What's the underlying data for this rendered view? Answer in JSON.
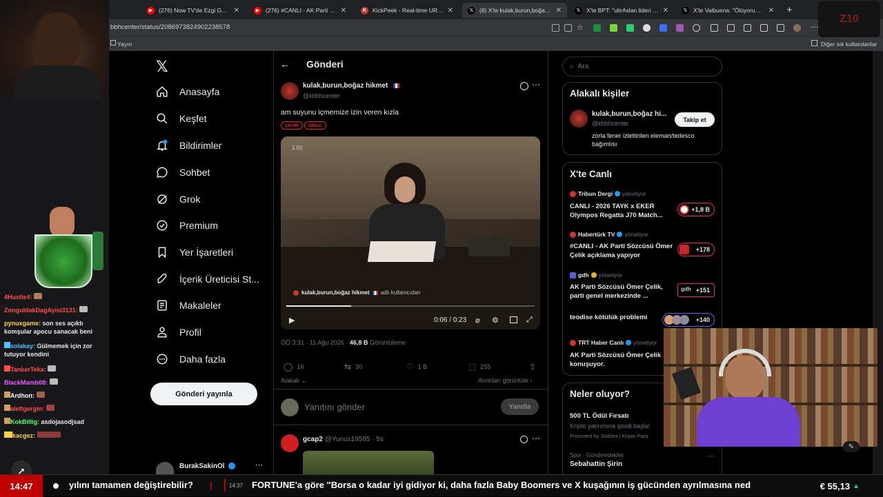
{
  "browser": {
    "tabs": [
      {
        "title": "(276) Now TV'de Ezgi Gözeger ile",
        "icon": "youtube-icon"
      },
      {
        "title": "(276) #CANLI - AK Parti Sözc",
        "icon": "youtube-icon"
      },
      {
        "title": "KickPeek - Real-time URL Crawle",
        "icon": "kickpeek-icon"
      },
      {
        "title": "(6) X'te kulak,burun,boğaz hikme",
        "icon": "x-icon"
      },
      {
        "title": "X'te BPT: \"ultrAslan lideri Sebaha",
        "icon": "x-icon"
      },
      {
        "title": "X'te Valbuena: \"Ölüyorum amk P",
        "icon": "x-icon"
      }
    ],
    "url": "bbhcenter/status/2086973824902238578",
    "bookmarks": {
      "left": "Yayın",
      "right": "Diğer sık kullanılanlar"
    }
  },
  "nav": {
    "items": [
      "Anasayfa",
      "Keşfet",
      "Bildirimler",
      "Sohbet",
      "Grok",
      "Premium",
      "Yer İşaretleri",
      "İçerik Üreticisi St...",
      "Makaleler",
      "Profil",
      "Daha fazla"
    ],
    "post_button": "Gönderi yayınla",
    "account_name": "BurakSakinOl"
  },
  "header": {
    "title": "Gönderi"
  },
  "post": {
    "author_name": "kulak,burun,boğaz hikmet",
    "handle": "@kbbhcenter",
    "text": "am suyunu içmemize izin veren kızla",
    "tags": [
      "ÇEVİR",
      "DİNLE"
    ],
    "video": {
      "speed": "1.00",
      "overlay_author": "kulak,burun,boğaz hikmet",
      "overlay_suffix": "adlı kullanıcıdan",
      "time": "0:06 / 0:23",
      "progress": 0.26
    },
    "meta": {
      "time": "ÖÖ 3:31 · 11 Ağu 2026 ·",
      "views": "46,8 B",
      "views_label": "Görüntüleme"
    },
    "stats": {
      "replies": "16",
      "reposts": "30",
      "likes": "1 B",
      "bookmarks": "255"
    },
    "related_label": "Alakalı",
    "quotes_label": "Alıntıları görüntüle",
    "reply_placeholder": "Yanıtını gönder",
    "reply_button": "Yanıtla"
  },
  "next_post": {
    "name": "gcap2",
    "handle": "@Yunus19595",
    "age": "5s"
  },
  "sidebar": {
    "search_placeholder": "Ara",
    "related_people": {
      "title": "Alakalı kişiler",
      "name": "kulak,burun,boğaz hi...",
      "handle": "@kbbhcenter",
      "bio": "zorla fener izlettirilen eleman/tedesco bağımlısı",
      "follow": "Takip et"
    },
    "live": {
      "title": "X'te Canlı",
      "items": [
        {
          "source": "Tribun Dergi",
          "role": "yönetiyor",
          "text": "CANLI - 2026 TAYK x EKER Olympos Regatta J70 Match...",
          "count": "+1,8 B"
        },
        {
          "source": "Habertürk TV",
          "role": "yönetiyor",
          "text": "#CANLI - AK Parti Sözcüsü Ömer Çelik açıklama yapıyor",
          "count": "+178"
        },
        {
          "source": "gdh",
          "role": "yönetiyor",
          "text": "AK Parti Sözcüsü Ömer Çelik, parti genel merkezinde ...",
          "count": "+151"
        },
        {
          "source": "",
          "role": "",
          "text": "teodise kötülük problemi",
          "count": "+140"
        },
        {
          "source": "TRT Haber Canlı",
          "role": "yönetiyor",
          "text": "AK Parti Sözcüsü Ömer Çelik konuşuyor.",
          "count": ""
        }
      ]
    },
    "trending": {
      "title": "Neler oluyor?",
      "promo_title": "500 TL Ödül Fırsatı",
      "promo_text": "Kripto yatırımına şimdi başla!",
      "promo_by": "Promoted by Stablex | Kripto Para",
      "trend_context": "Spor · Gündemdekiler",
      "trend_name": "Sebahattin Şirin"
    }
  },
  "stream_chat": [
    {
      "user": "4Hustle4:",
      "msg": "",
      "color": "#ff4d4d"
    },
    {
      "user": "ZonguldakDagAyisi3131:",
      "msg": "",
      "color": "#ff4d4d"
    },
    {
      "user": "pynuxgame:",
      "msg": "son ses açıktı komşular apocu sanacak beni",
      "color": "#ffd24d"
    },
    {
      "user": "solakay:",
      "msg": "Gülmemek için zor tutuyor kendini",
      "color": "#4dc3ff"
    },
    {
      "user": "TankerTeka:",
      "msg": "",
      "color": "#ff4d4d"
    },
    {
      "user": "BlackMamb08:",
      "msg": "",
      "color": "#e85dff"
    },
    {
      "user": "Ardhon:",
      "msg": "",
      "color": "#ffffff"
    },
    {
      "user": "alettgergin:",
      "msg": "",
      "color": "#ff4d4d"
    },
    {
      "user": "KokBillig:",
      "msg": "asdojasodjsad",
      "color": "#5cff6b"
    },
    {
      "user": "kacgez:",
      "msg": "",
      "color": "#ffd24d"
    }
  ],
  "ticker": {
    "clock": "14:47",
    "text1": "yılını tamamen değiştirebilir?",
    "time2": "14:37",
    "text2": "FORTUNE'a göre \"Borsa o kadar iyi gidiyor ki, daha fazla Baby Boomers ve X kuşağının iş gücünden ayrılmasına ned",
    "price": "€ 55,13"
  },
  "colors": {
    "accent": "#1d9bf0",
    "live": "#f91880",
    "tag": "#f4212e"
  }
}
